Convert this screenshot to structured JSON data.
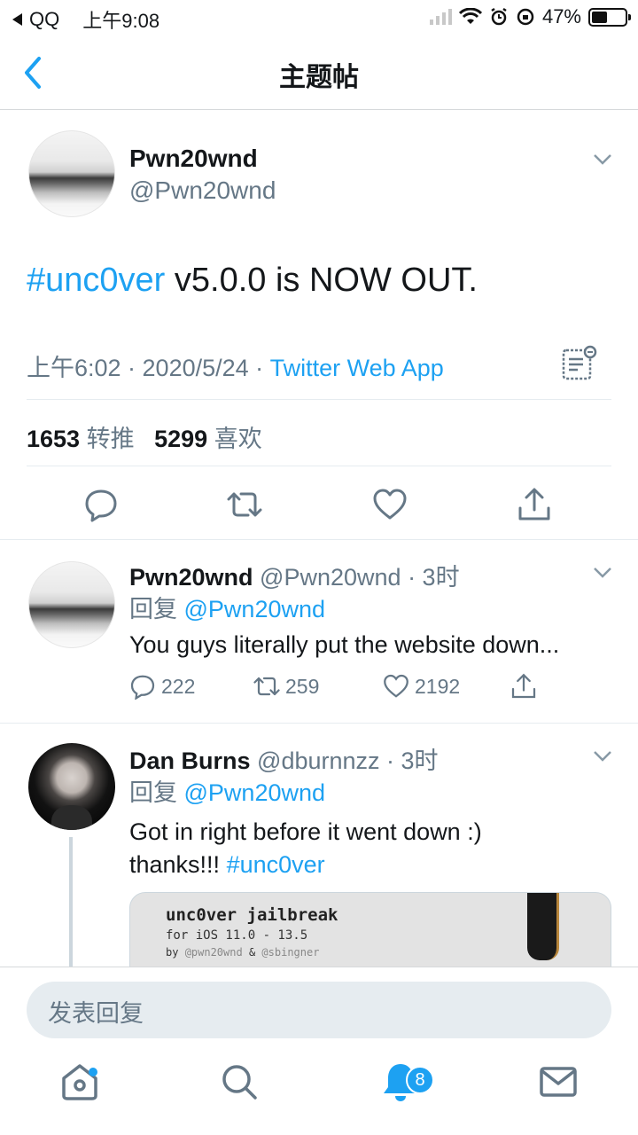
{
  "status_bar": {
    "back_app": "QQ",
    "time": "上午9:08",
    "battery": "47%"
  },
  "nav": {
    "title": "主题帖"
  },
  "tweet": {
    "name": "Pwn20wnd",
    "handle": "@Pwn20wnd",
    "hashtag": "#unc0ver",
    "text_rest": " v5.0.0 is NOW OUT.",
    "meta_time": "上午6:02 · 2020/5/24 · ",
    "source": "Twitter Web App",
    "retweets_count": "1653",
    "retweets_label": "转推",
    "likes_count": "5299",
    "likes_label": "喜欢"
  },
  "replies": [
    {
      "name": "Pwn20wnd",
      "handle": "@Pwn20wnd",
      "time": "· 3时",
      "reply_prefix": "回复",
      "reply_to": "@Pwn20wnd",
      "text": "You guys literally put the website down...",
      "reply_count": "222",
      "retweet_count": "259",
      "like_count": "2192"
    },
    {
      "name": "Dan Burns",
      "handle": "@dburnnzz",
      "time": "· 3时",
      "reply_prefix": "回复",
      "reply_to": "@Pwn20wnd",
      "text_line1": "Got in right before it went down :)",
      "text_line2": "thanks!!! ",
      "hashtag": "#unc0ver",
      "card": {
        "title": "unc0ver jailbreak",
        "subtitle": "for iOS 11.0 - 13.5",
        "by": "by",
        "author1": "@pwn20wnd",
        "amp": "&",
        "author2": "@sbingner"
      }
    }
  ],
  "compose": {
    "placeholder": "发表回复"
  },
  "tabbar": {
    "notifications_badge": "8"
  },
  "colors": {
    "accent": "#1da1f2",
    "text": "#14171a",
    "secondary": "#657786",
    "border": "#e6ecf0"
  }
}
